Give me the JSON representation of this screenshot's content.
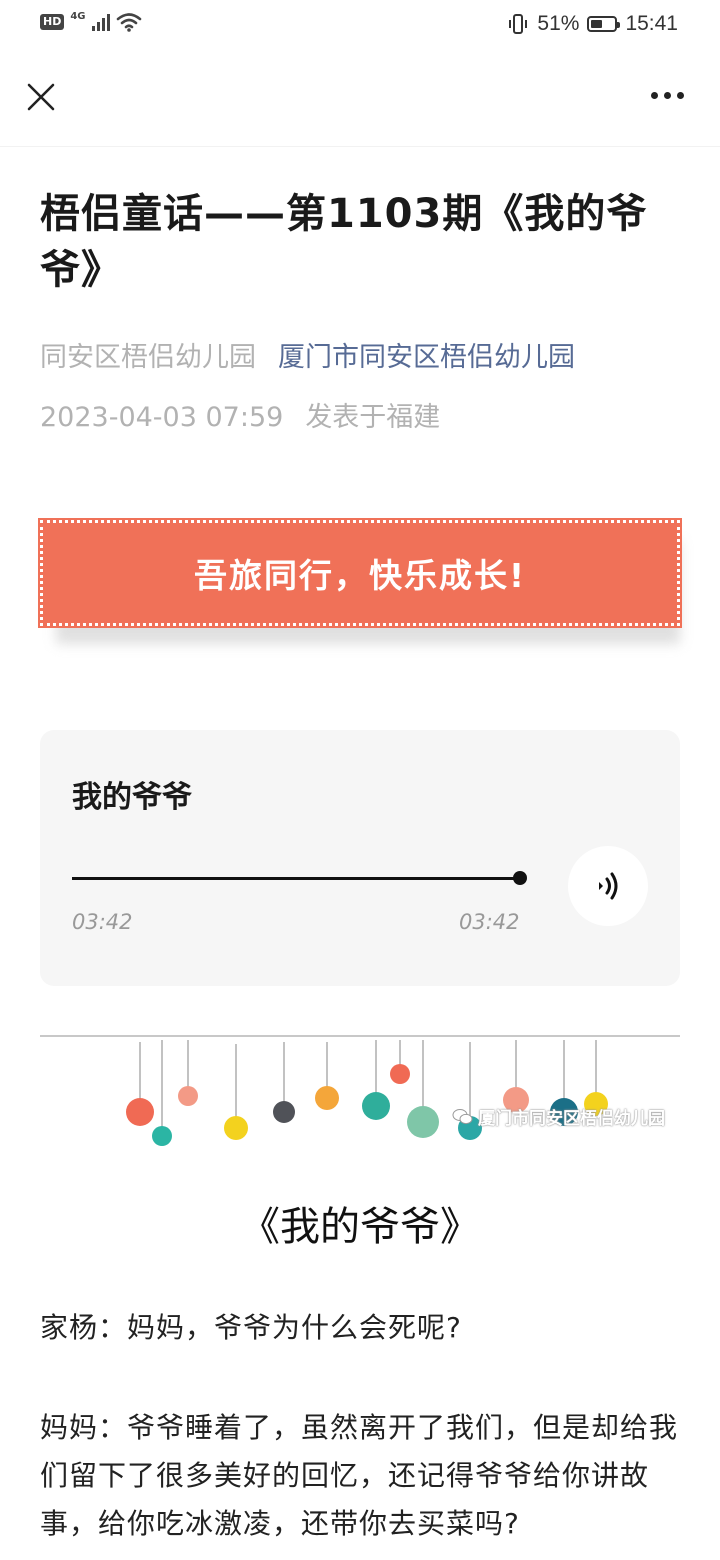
{
  "status_bar": {
    "hd": "HD",
    "network": "4G",
    "battery_percent": "51%",
    "battery_level": 0.51,
    "time": "15:41"
  },
  "nav": {
    "close_icon": "close-icon",
    "more_icon": "more-dots-icon"
  },
  "article": {
    "title": "梧侣童话——第1103期《我的爷爷》",
    "author": "同安区梧侣幼儿园",
    "account": "厦门市同安区梧侣幼儿园",
    "datetime": "2023-04-03 07:59",
    "location": "发表于福建"
  },
  "banner": {
    "text": "吾旅同行，快乐成长!",
    "color": "#f07158"
  },
  "audio": {
    "title": "我的爷爷",
    "current_time": "03:42",
    "total_time": "03:42",
    "progress": 1.0
  },
  "decoration": {
    "watermark": "厦门市同安区梧侣幼儿园"
  },
  "story": {
    "title": "《我的爷爷》",
    "paragraphs": [
      "家杨：妈妈，爷爷为什么会死呢?",
      "妈妈：爷爷睡着了，虽然离开了我们，但是却给我们留下了很多美好的回忆，还记得爷爷给你讲故事，给你吃冰激凌，还带你去买菜吗?"
    ]
  },
  "colors": {
    "link": "#576b95",
    "meta": "#b2b2b2",
    "card_bg": "#f6f6f6"
  }
}
